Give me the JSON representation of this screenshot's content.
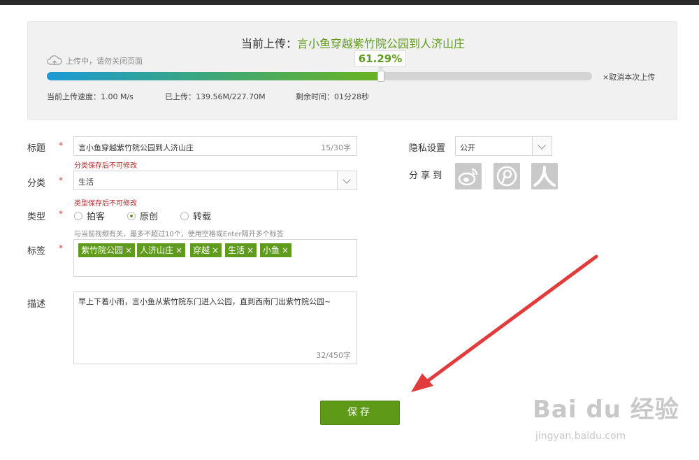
{
  "upload": {
    "title_prefix": "当前上传：",
    "file_name": "言小鱼穿越紫竹院公园到人济山庄",
    "status": "上传中，请勿关闭页面",
    "percent_label": "61.29%",
    "progress_fraction": 0.6129,
    "cancel": "×取消本次上传",
    "speed": "当前上传速度：1.00 M/s",
    "uploaded": "已上传：139.56M/227.70M",
    "remaining": "剩余时间：01分28秒"
  },
  "form": {
    "title_label": "标题",
    "title_value": "言小鱼穿越紫竹院公园到人济山庄",
    "title_count": "15/30字",
    "category_hint": "分类保存后不可修改",
    "category_label": "分类",
    "category_value": "生活",
    "type_hint": "类型保存后不可修改",
    "type_label": "类型",
    "type_options": [
      "拍客",
      "原创",
      "转载"
    ],
    "type_selected": "原创",
    "tags_hint": "与当前视频有关，最多不超过10个，使用空格或Enter隔开多个标签",
    "tags_label": "标签",
    "tags": [
      "紫竹院公园",
      "人济山庄",
      "穿越",
      "生活",
      "小鱼"
    ],
    "desc_label": "描述",
    "desc_value": "早上下着小雨，言小鱼从紫竹院东门进入公园，直到西南门出紫竹院公园~",
    "desc_count": "32/450字",
    "required_mark": "*",
    "privacy_label": "隐私设置",
    "privacy_value": "公开",
    "share_label": "分 享 到",
    "share_icons": [
      "weibo-icon",
      "tencent-weibo-icon",
      "renren-icon"
    ]
  },
  "save_label": "保存",
  "watermark": {
    "brand": "Bai du 经验",
    "url": "jingyan.baidu.com"
  },
  "colors": {
    "accent": "#5f9b1c",
    "required": "#d9403a",
    "arrow": "#e23b3b"
  }
}
